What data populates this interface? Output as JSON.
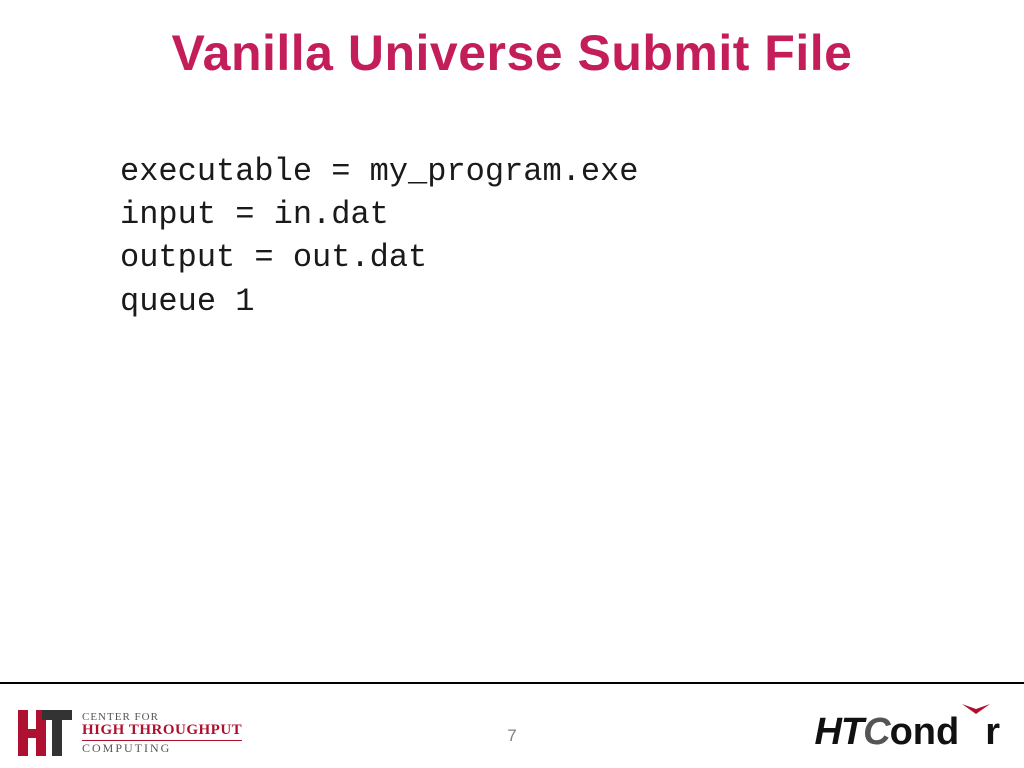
{
  "title": "Vanilla Universe Submit File",
  "code": {
    "line1": "executable = my_program.exe",
    "line2": "input = in.dat",
    "line3": "output = out.dat",
    "line4": "queue 1"
  },
  "page_number": "7",
  "footer": {
    "left": {
      "line1": "CENTER FOR",
      "line2": "HIGH THROUGHPUT",
      "line3": "COMPUTING"
    },
    "right": {
      "part1": "HT",
      "part2": "C",
      "part3": "ond",
      "part4": "r"
    }
  }
}
